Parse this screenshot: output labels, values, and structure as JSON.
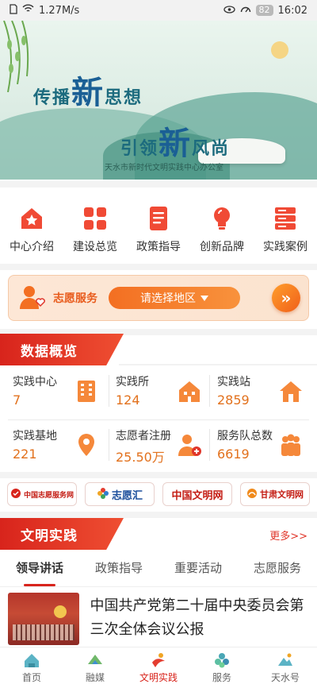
{
  "status_bar": {
    "speed": "1.27M/s",
    "battery": "82",
    "time": "16:02"
  },
  "banner": {
    "line1_prefix": "传播",
    "line1_big": "新",
    "line1_suffix": "思想",
    "line2_prefix": "引领",
    "line2_big": "新",
    "line2_suffix": "风尚",
    "credit": "天水市新时代文明实践中心办公室"
  },
  "quick_menu": [
    {
      "label": "中心介绍",
      "icon": "house-star-icon"
    },
    {
      "label": "建设总览",
      "icon": "grid-icon"
    },
    {
      "label": "政策指导",
      "icon": "document-icon"
    },
    {
      "label": "创新品牌",
      "icon": "lightbulb-icon"
    },
    {
      "label": "实践案例",
      "icon": "server-stack-icon"
    }
  ],
  "volunteer": {
    "title": "志愿服务",
    "select_label": "请选择地区",
    "arrow_text": "»"
  },
  "data_overview": {
    "title": "数据概览",
    "stats": [
      {
        "label": "实践中心",
        "value": "7",
        "icon": "building-icon"
      },
      {
        "label": "实践所",
        "value": "124",
        "icon": "house-icon"
      },
      {
        "label": "实践站",
        "value": "2859",
        "icon": "home-icon"
      },
      {
        "label": "实践基地",
        "value": "221",
        "icon": "location-pin-icon"
      },
      {
        "label": "志愿者注册",
        "value": "25.50万",
        "icon": "user-add-icon"
      },
      {
        "label": "服务队总数",
        "value": "6619",
        "icon": "team-icon"
      }
    ]
  },
  "partner_links": [
    {
      "text": "中国志愿服务网"
    },
    {
      "text": "志愿汇"
    },
    {
      "text": "中国文明网"
    },
    {
      "text": "甘肃文明网"
    }
  ],
  "civilization": {
    "title": "文明实践",
    "more": "更多>>",
    "tabs": [
      "领导讲话",
      "政策指导",
      "重要活动",
      "志愿服务"
    ],
    "active_tab": 0,
    "news": [
      {
        "title": "中国共产党第二十届中央委员会第三次全体会议公报"
      }
    ]
  },
  "bottom_nav": [
    {
      "label": "首页",
      "icon": "home-nav-icon"
    },
    {
      "label": "融媒",
      "icon": "media-icon"
    },
    {
      "label": "文明实践",
      "icon": "practice-icon",
      "active": true
    },
    {
      "label": "服务",
      "icon": "service-icon"
    },
    {
      "label": "天水号",
      "icon": "tianshui-icon"
    }
  ],
  "colors": {
    "primary_red": "#d8241c",
    "accent_orange": "#e2711d"
  }
}
